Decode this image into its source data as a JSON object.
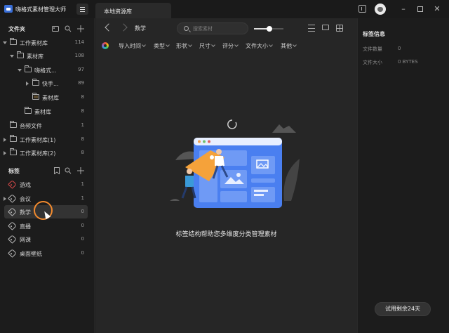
{
  "titlebar": {
    "app_name": "嗨格式素材管理大师",
    "tab_label": "本地资源库",
    "icons": [
      "app-logo-icon",
      "menu-icon",
      "sidebar-toggle-icon",
      "user-avatar",
      "minimize-icon",
      "maximize-icon",
      "close-icon"
    ]
  },
  "sidebar": {
    "folders_title": "文件夹",
    "folders": [
      {
        "label": "工作素材库",
        "count": "114"
      },
      {
        "label": "素材库",
        "count": "108"
      },
      {
        "label": "嗨格式...",
        "count": "97"
      },
      {
        "label": "快手...",
        "count": "89"
      },
      {
        "label": "素材库",
        "count": "8"
      },
      {
        "label": "素材库",
        "count": "8"
      },
      {
        "label": "音频文件",
        "count": "1"
      },
      {
        "label": "工作素材库(1)",
        "count": "8"
      },
      {
        "label": "工作素材库(2)",
        "count": "8"
      }
    ],
    "tags_title": "标签",
    "tags": [
      {
        "label": "游戏",
        "count": "1",
        "color": "#d94a4a"
      },
      {
        "label": "会议",
        "count": "1",
        "color": "#bbbbbb"
      },
      {
        "label": "数学",
        "count": "0",
        "color": "#bbbbbb"
      },
      {
        "label": "直播",
        "count": "0",
        "color": "#bbbbbb"
      },
      {
        "label": "网课",
        "count": "0",
        "color": "#bbbbbb"
      },
      {
        "label": "桌面壁纸",
        "count": "0",
        "color": "#bbbbbb"
      }
    ]
  },
  "main": {
    "breadcrumb": "数学",
    "search_placeholder": "搜索素材",
    "zoom_level": 0.5,
    "filters": [
      "导入时间",
      "类型",
      "形状",
      "尺寸",
      "评分",
      "文件大小",
      "其他"
    ],
    "empty_caption": "标签结构帮助您多维度分类管理素材"
  },
  "right_panel": {
    "title": "标签信息",
    "file_count_label": "文件数量",
    "file_count_value": "0",
    "file_size_label": "文件大小",
    "file_size_value": "0 BYTES",
    "trial_button": "试用剩余24天"
  },
  "colors": {
    "accent_blue": "#4a7ff0",
    "tag_orange": "#f5a23a",
    "cursor_ring": "#f28a2e"
  }
}
